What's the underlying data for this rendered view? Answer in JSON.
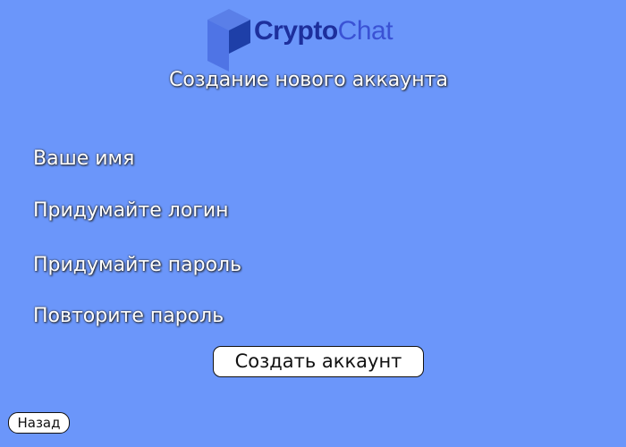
{
  "logo": {
    "icon": "crypto-chat-logo-mark",
    "word1": "Crypto",
    "word2": "Chat"
  },
  "title": "Создание нового аккаунта",
  "fields": [
    {
      "label": "Ваше имя"
    },
    {
      "label": "Придумайте логин"
    },
    {
      "label": "Придумайте пароль"
    },
    {
      "label": "Повторите пароль"
    }
  ],
  "create_button": "Создать аккаунт",
  "back_button": "Назад",
  "colors": {
    "background": "#6b96fa",
    "logo_dark": "#1d2f9c",
    "logo_light": "#3a52d4"
  }
}
